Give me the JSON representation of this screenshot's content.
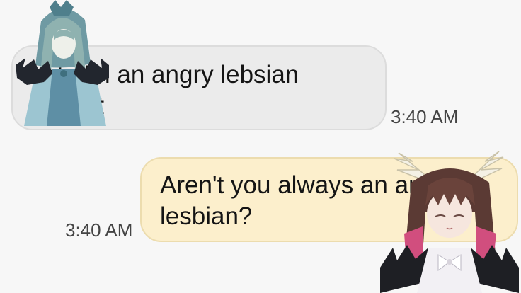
{
  "messages": [
    {
      "direction": "incoming",
      "text_line1": "ugh I'm an angry lebsian",
      "text_line2": "tonight",
      "time": "3:40 AM"
    },
    {
      "direction": "outgoing",
      "text_line1": "Aren't you always an angry",
      "text_line2": "lesbian?",
      "time": "3:40 AM"
    }
  ],
  "colors": {
    "incoming_bubble": "#ebebeb",
    "outgoing_bubble": "#fcefcc",
    "background": "#f7f7f7"
  },
  "overlays": [
    "anime-character-left-sticker",
    "anime-character-right-sticker"
  ]
}
